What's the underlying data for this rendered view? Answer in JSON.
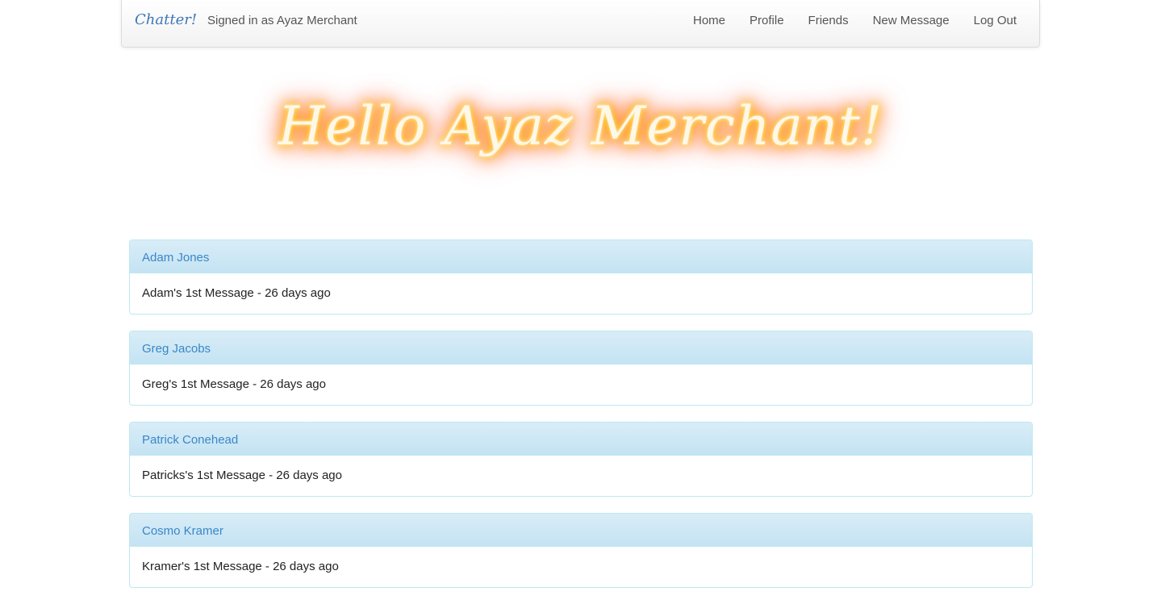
{
  "navbar": {
    "brand": "Chatter!",
    "signed_in_text": "Signed in as Ayaz Merchant",
    "links": [
      "Home",
      "Profile",
      "Friends",
      "New Message",
      "Log Out"
    ]
  },
  "hero": {
    "title": "Hello Ayaz Merchant!"
  },
  "messages": [
    {
      "author": "Adam Jones",
      "text": "Adam's 1st Message - 26 days ago"
    },
    {
      "author": "Greg Jacobs",
      "text": "Greg's 1st Message - 26 days ago"
    },
    {
      "author": "Patrick Conehead",
      "text": "Patricks's 1st Message - 26 days ago"
    },
    {
      "author": "Cosmo Kramer",
      "text": "Kramer's 1st Message - 26 days ago"
    }
  ],
  "colors": {
    "link": "#3a87c8",
    "panel_heading": "#d9edf7",
    "panel_border": "#bce8f1",
    "glow": "#ff9a00"
  }
}
